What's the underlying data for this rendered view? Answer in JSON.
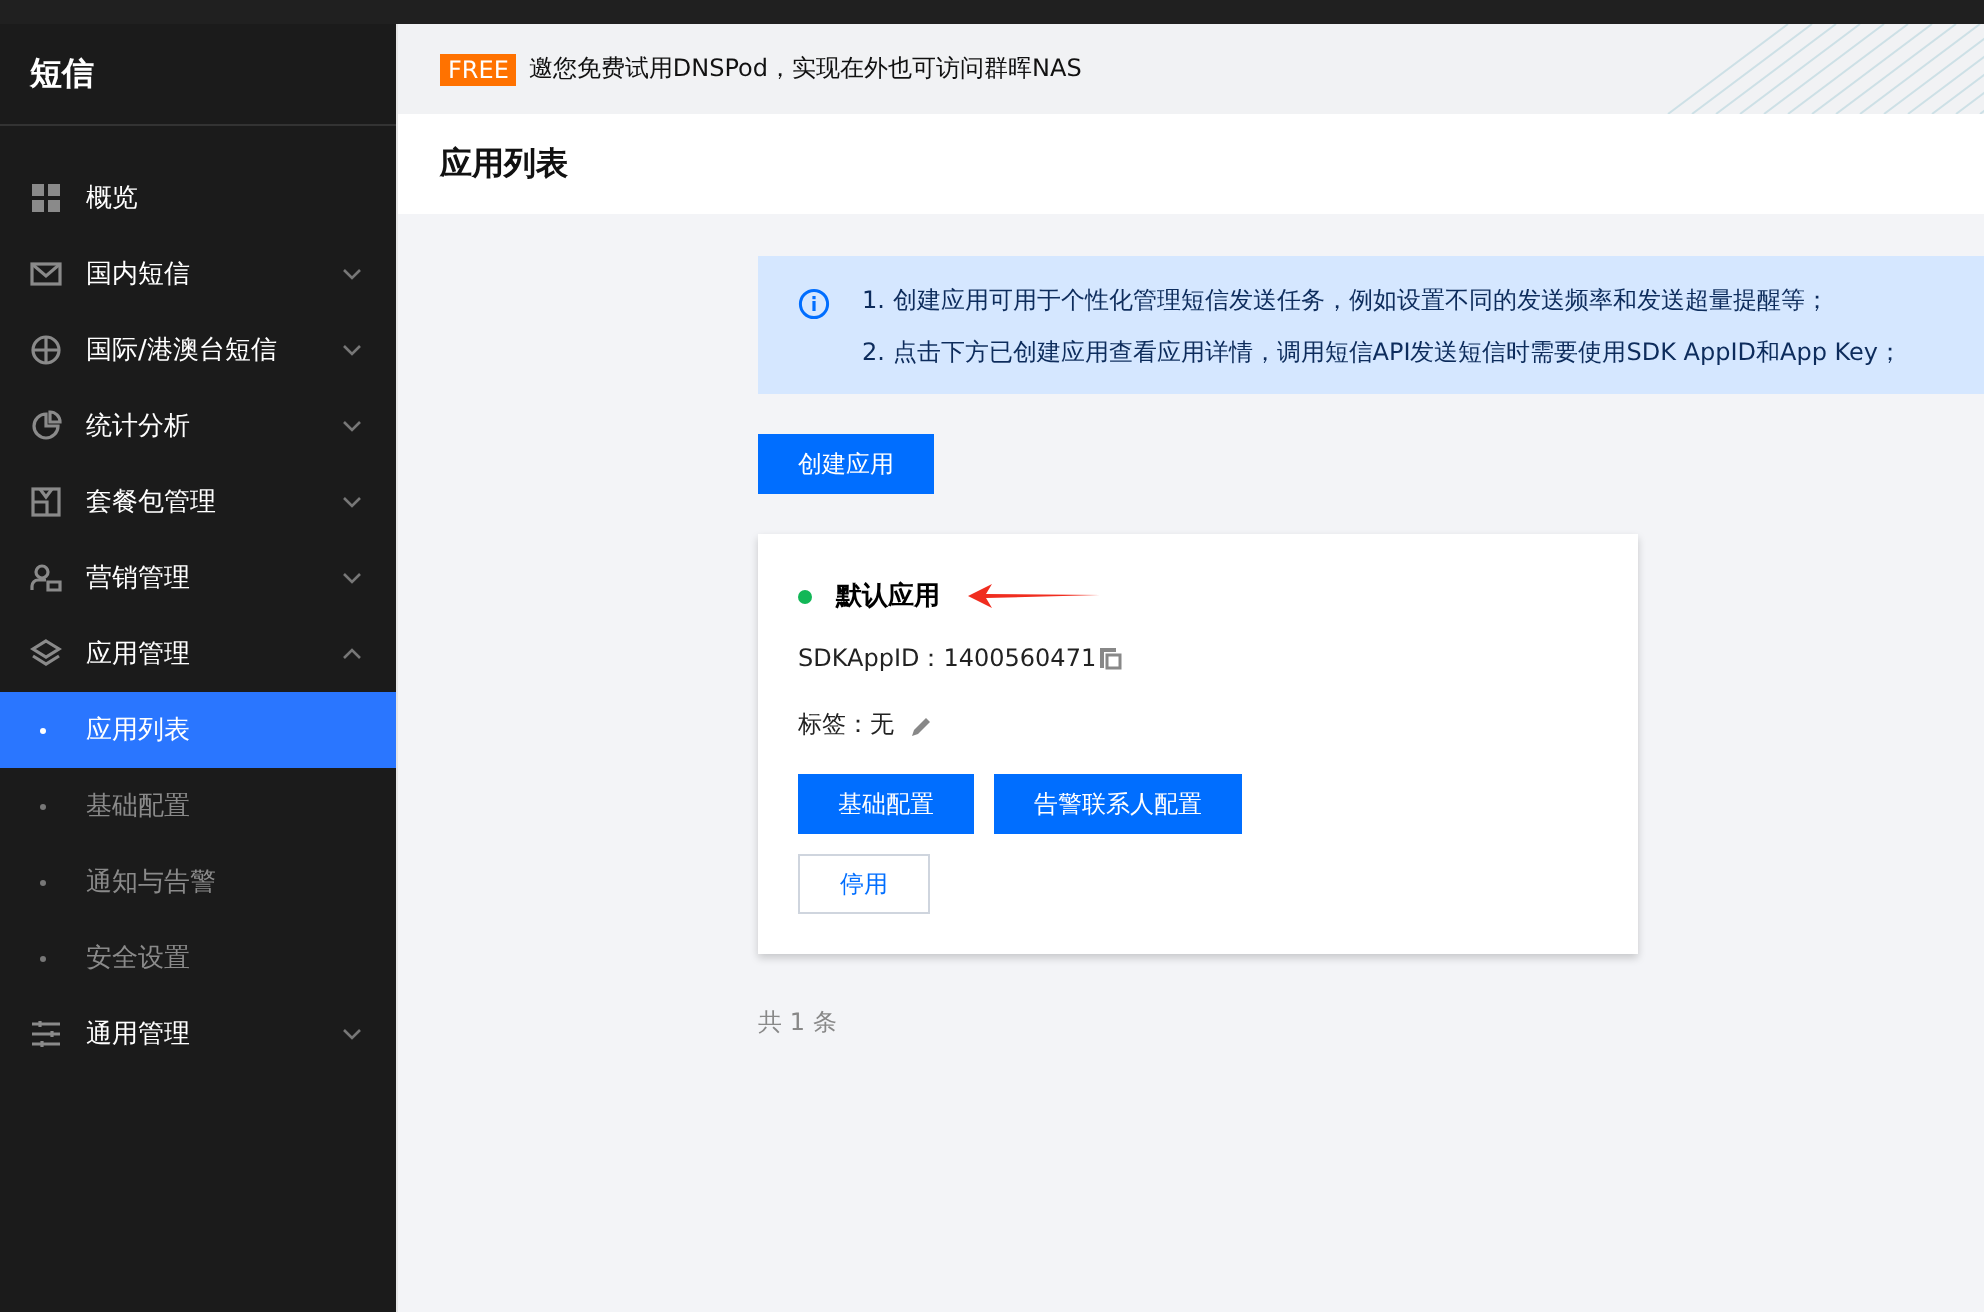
{
  "sidebar": {
    "title": "短信",
    "items": [
      {
        "label": "概览"
      },
      {
        "label": "国内短信",
        "expanded": false
      },
      {
        "label": "国际/港澳台短信",
        "expanded": false
      },
      {
        "label": "统计分析",
        "expanded": false
      },
      {
        "label": "套餐包管理",
        "expanded": false
      },
      {
        "label": "营销管理",
        "expanded": false
      },
      {
        "label": "应用管理",
        "expanded": true,
        "children": [
          {
            "label": "应用列表",
            "selected": true
          },
          {
            "label": "基础配置",
            "selected": false
          },
          {
            "label": "通知与告警",
            "selected": false
          },
          {
            "label": "安全设置",
            "selected": false
          }
        ]
      },
      {
        "label": "通用管理",
        "expanded": false
      }
    ]
  },
  "banner": {
    "badge": "FREE",
    "text": "邀您免费试用DNSPod，实现在外也可访问群晖NAS"
  },
  "page_title": "应用列表",
  "notice": [
    "1. 创建应用可用于个性化管理短信发送任务，例如设置不同的发送频率和发送超量提醒等；",
    "2. 点击下方已创建应用查看应用详情，调用短信API发送短信时需要使用SDK AppID和App Key；"
  ],
  "create_button": "创建应用",
  "apps": [
    {
      "name": "默认应用",
      "color": "#12b757",
      "sdk_label": "SDKAppID：",
      "sdk_app_id": "1400560471",
      "tag_label": "标签：",
      "tag_value": "无",
      "buttons": [
        "基础配置",
        "告警联系人配置"
      ],
      "disable_button": "停用"
    }
  ],
  "total": "共 1 条"
}
